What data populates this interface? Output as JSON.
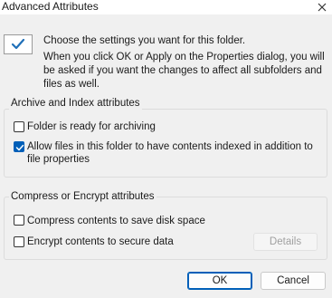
{
  "window": {
    "title": "Advanced Attributes"
  },
  "intro": {
    "line1": "Choose the settings you want for this folder.",
    "line2": "When you click OK or Apply on the Properties dialog, you will be asked if you want the changes to affect all subfolders and files as well."
  },
  "archive_group": {
    "label": "Archive and Index attributes",
    "archiving": {
      "label": "Folder is ready for archiving",
      "checked": false
    },
    "indexing": {
      "label": "Allow files in this folder to have contents indexed in addition to file properties",
      "checked": true
    }
  },
  "compress_group": {
    "label": "Compress or Encrypt attributes",
    "compress": {
      "label": "Compress contents to save disk space",
      "checked": false
    },
    "encrypt": {
      "label": "Encrypt contents to secure data",
      "checked": false
    },
    "details_label": "Details"
  },
  "buttons": {
    "ok_label": "OK",
    "cancel_label": "Cancel"
  },
  "colors": {
    "accent": "#005fb8",
    "folder": "#e8b33a"
  }
}
